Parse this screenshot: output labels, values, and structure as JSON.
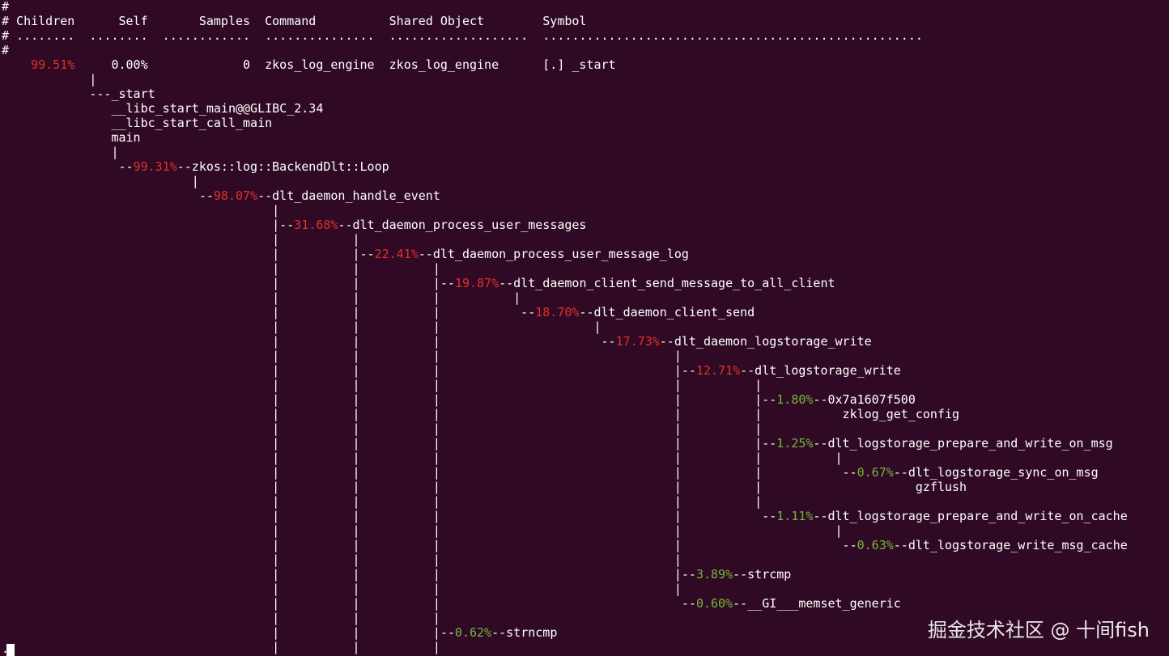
{
  "terminal": {
    "lines": [
      [
        {
          "t": "#",
          "c": "white"
        }
      ],
      [
        {
          "t": "# Children      Self       Samples  Command          Shared Object        Symbol",
          "c": "white"
        }
      ],
      [
        {
          "t": "# ........  ........  ............  ...............  ...................  ....................................................",
          "c": "white"
        }
      ],
      [
        {
          "t": "#",
          "c": "white"
        }
      ],
      [
        {
          "t": "    ",
          "c": "white"
        },
        {
          "t": "99.51%",
          "c": "red"
        },
        {
          "t": "     0.00%             0  zkos_log_engine  zkos_log_engine      [.] _start",
          "c": "white"
        }
      ],
      [
        {
          "t": "            |",
          "c": "white"
        }
      ],
      [
        {
          "t": "            ---_start",
          "c": "white"
        }
      ],
      [
        {
          "t": "               __libc_start_main@@GLIBC_2.34",
          "c": "white"
        }
      ],
      [
        {
          "t": "               __libc_start_call_main",
          "c": "white"
        }
      ],
      [
        {
          "t": "               main",
          "c": "white"
        }
      ],
      [
        {
          "t": "               |",
          "c": "white"
        }
      ],
      [
        {
          "t": "                --",
          "c": "white"
        },
        {
          "t": "99.31%",
          "c": "red"
        },
        {
          "t": "--zkos::log::BackendDlt::Loop",
          "c": "white"
        }
      ],
      [
        {
          "t": "                          |",
          "c": "white"
        }
      ],
      [
        {
          "t": "                           --",
          "c": "white"
        },
        {
          "t": "98.07%",
          "c": "red"
        },
        {
          "t": "--dlt_daemon_handle_event",
          "c": "white"
        }
      ],
      [
        {
          "t": "                                     |",
          "c": "white"
        }
      ],
      [
        {
          "t": "                                     |--",
          "c": "white"
        },
        {
          "t": "31.68%",
          "c": "red"
        },
        {
          "t": "--dlt_daemon_process_user_messages",
          "c": "white"
        }
      ],
      [
        {
          "t": "                                     |          |",
          "c": "white"
        }
      ],
      [
        {
          "t": "                                     |          |--",
          "c": "white"
        },
        {
          "t": "22.41%",
          "c": "red"
        },
        {
          "t": "--dlt_daemon_process_user_message_log",
          "c": "white"
        }
      ],
      [
        {
          "t": "                                     |          |          |",
          "c": "white"
        }
      ],
      [
        {
          "t": "                                     |          |          |--",
          "c": "white"
        },
        {
          "t": "19.87%",
          "c": "red"
        },
        {
          "t": "--dlt_daemon_client_send_message_to_all_client",
          "c": "white"
        }
      ],
      [
        {
          "t": "                                     |          |          |          |",
          "c": "white"
        }
      ],
      [
        {
          "t": "                                     |          |          |           --",
          "c": "white"
        },
        {
          "t": "18.70%",
          "c": "red"
        },
        {
          "t": "--dlt_daemon_client_send",
          "c": "white"
        }
      ],
      [
        {
          "t": "                                     |          |          |                     |",
          "c": "white"
        }
      ],
      [
        {
          "t": "                                     |          |          |                      --",
          "c": "white"
        },
        {
          "t": "17.73%",
          "c": "red"
        },
        {
          "t": "--dlt_daemon_logstorage_write",
          "c": "white"
        }
      ],
      [
        {
          "t": "                                     |          |          |                                |",
          "c": "white"
        }
      ],
      [
        {
          "t": "                                     |          |          |                                |--",
          "c": "white"
        },
        {
          "t": "12.71%",
          "c": "red"
        },
        {
          "t": "--dlt_logstorage_write",
          "c": "white"
        }
      ],
      [
        {
          "t": "                                     |          |          |                                |          |",
          "c": "white"
        }
      ],
      [
        {
          "t": "                                     |          |          |                                |          |--",
          "c": "white"
        },
        {
          "t": "1.80%",
          "c": "green"
        },
        {
          "t": "--0x7a1607f500",
          "c": "white"
        }
      ],
      [
        {
          "t": "                                     |          |          |                                |          |           zklog_get_config",
          "c": "white"
        }
      ],
      [
        {
          "t": "                                     |          |          |                                |          |",
          "c": "white"
        }
      ],
      [
        {
          "t": "                                     |          |          |                                |          |--",
          "c": "white"
        },
        {
          "t": "1.25%",
          "c": "green"
        },
        {
          "t": "--dlt_logstorage_prepare_and_write_on_msg",
          "c": "white"
        }
      ],
      [
        {
          "t": "                                     |          |          |                                |          |          |",
          "c": "white"
        }
      ],
      [
        {
          "t": "                                     |          |          |                                |          |           --",
          "c": "white"
        },
        {
          "t": "0.67%",
          "c": "green"
        },
        {
          "t": "--dlt_logstorage_sync_on_msg",
          "c": "white"
        }
      ],
      [
        {
          "t": "                                     |          |          |                                |          |                     gzflush",
          "c": "white"
        }
      ],
      [
        {
          "t": "                                     |          |          |                                |          |",
          "c": "white"
        }
      ],
      [
        {
          "t": "                                     |          |          |                                |           --",
          "c": "white"
        },
        {
          "t": "1.11%",
          "c": "green"
        },
        {
          "t": "--dlt_logstorage_prepare_and_write_on_cache",
          "c": "white"
        }
      ],
      [
        {
          "t": "                                     |          |          |                                |                     |",
          "c": "white"
        }
      ],
      [
        {
          "t": "                                     |          |          |                                |                      --",
          "c": "white"
        },
        {
          "t": "0.63%",
          "c": "green"
        },
        {
          "t": "--dlt_logstorage_write_msg_cache",
          "c": "white"
        }
      ],
      [
        {
          "t": "                                     |          |          |                                |",
          "c": "white"
        }
      ],
      [
        {
          "t": "                                     |          |          |                                |--",
          "c": "white"
        },
        {
          "t": "3.89%",
          "c": "green"
        },
        {
          "t": "--strcmp",
          "c": "white"
        }
      ],
      [
        {
          "t": "                                     |          |          |                                |",
          "c": "white"
        }
      ],
      [
        {
          "t": "                                     |          |          |                                 --",
          "c": "white"
        },
        {
          "t": "0.60%",
          "c": "green"
        },
        {
          "t": "--__GI___memset_generic",
          "c": "white"
        }
      ],
      [
        {
          "t": "                                     |          |          |",
          "c": "white"
        }
      ],
      [
        {
          "t": "                                     |          |          |--",
          "c": "white"
        },
        {
          "t": "0.62%",
          "c": "green"
        },
        {
          "t": "--strncmp",
          "c": "white"
        }
      ],
      [
        {
          "t": "                                     |          |          |",
          "c": "white"
        }
      ]
    ],
    "prompt_char": "."
  },
  "watermark": "掘金技术社区 @ 十间fish",
  "colors": {
    "background": "#300a24",
    "text": "#ffffff",
    "red": "#e0312b",
    "green": "#73b73b"
  }
}
